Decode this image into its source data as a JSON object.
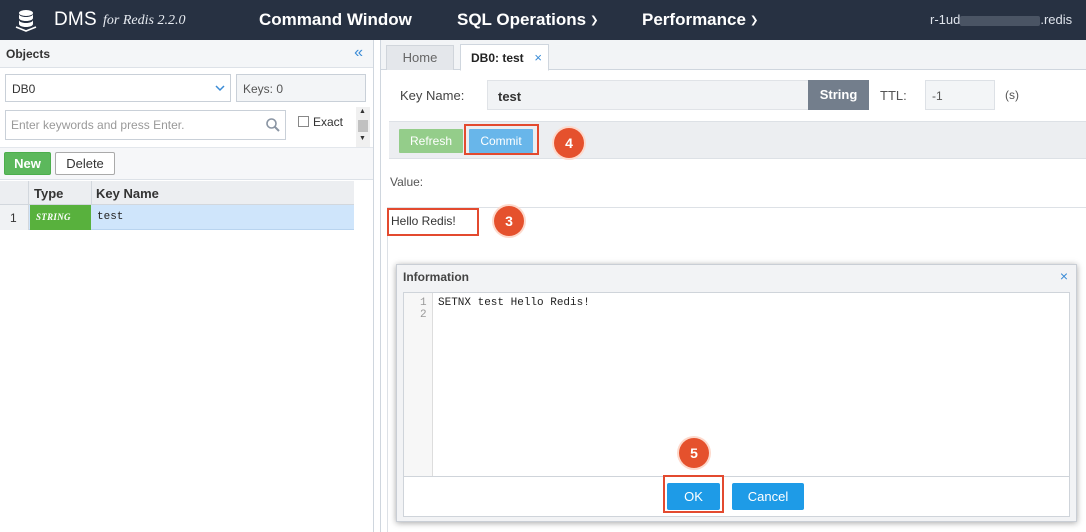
{
  "header": {
    "brand": "DMS",
    "brand_sub": "for Redis 2.2.0",
    "nav": {
      "command_window": "Command Window",
      "sql_operations": "SQL Operations",
      "performance": "Performance"
    },
    "instance_prefix": "r-1ud",
    "instance_suffix": ".redis",
    "bg_color": "#273142"
  },
  "objects_panel": {
    "title": "Objects",
    "database": "DB0",
    "keys_count": "Keys: 0",
    "search_placeholder": "Enter keywords and press Enter.",
    "exact_label": "Exact",
    "new_label": "New",
    "delete_label": "Delete",
    "columns": {
      "type": "Type",
      "key_name": "Key Name"
    },
    "rows": [
      {
        "num": "1",
        "type": "STRING",
        "key": "test"
      }
    ]
  },
  "tabs": {
    "home": "Home",
    "active": "DB0:  test",
    "close": "×"
  },
  "editor": {
    "key_name_label": "Key Name:",
    "key_name_value": "test",
    "type": "String",
    "ttl_label": "TTL:",
    "ttl_value": "-1",
    "ttl_unit": "(s)",
    "refresh_label": "Refresh",
    "commit_label": "Commit",
    "value_label": "Value:",
    "value_text": "Hello Redis!"
  },
  "dialog": {
    "title": "Information",
    "close": "×",
    "line_numbers": [
      "1",
      "2"
    ],
    "command": "SETNX test Hello Redis!",
    "ok_label": "OK",
    "cancel_label": "Cancel"
  },
  "annotations": {
    "step_value": "3",
    "step_commit": "4",
    "step_ok": "5",
    "highlight_color": "#e34a2f"
  }
}
